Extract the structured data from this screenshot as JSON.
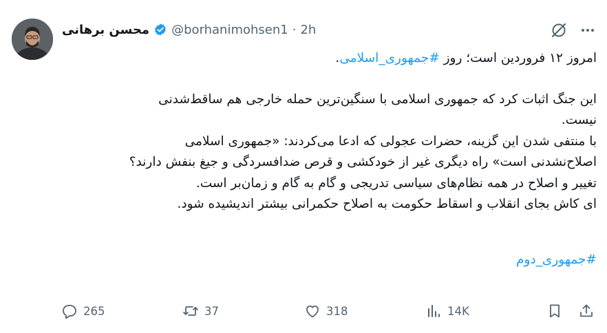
{
  "tweet": {
    "author_name": "محسن برهانی",
    "handle": "@borhanimohsen1",
    "separator": "·",
    "time": "2h",
    "line1_text": "امروز ۱۲ فروردین است؛ روز ",
    "line1_hashtag": "#جمهوری_اسلامی",
    "line1_end": ".",
    "para2_line1": "این جنگ اثبات کرد که جمهوری اسلامی با سنگین‌ترین حمله خارجی هم ساقط‌شدنی",
    "para2_line2": "نیست.",
    "para2_line3": "با منتفی شدن این گزینه، حضرات عجولی که ادعا می‌کردند: «جمهوری اسلامی",
    "para2_line4": "اصلاح‌نشدنی است» راه دیگری غیر از خودکشی و قرص ضدافسردگی و جیغ بنفش دارند؟",
    "para2_line5": "تغییر و اصلاح در همه نظام‌های سیاسی تدریجی و گام به گام و زمان‌بر است.",
    "para2_line6": "ای کاش بجای انقلاب و اسقاط حکومت به اصلاح حکمرانی بیشتر اندیشیده شود.",
    "final_hashtag": "#جمهوری_دوم"
  },
  "actions": {
    "replies": "265",
    "reposts": "37",
    "likes": "318",
    "views": "14K"
  },
  "colors": {
    "link": "#1d9bf0",
    "secondary": "#536471",
    "verified": "#1d9bf0"
  },
  "icons": [
    "verified-badge-icon",
    "grok-icon",
    "more-icon",
    "reply-icon",
    "repost-icon",
    "like-icon",
    "views-icon",
    "bookmark-icon",
    "share-icon"
  ]
}
